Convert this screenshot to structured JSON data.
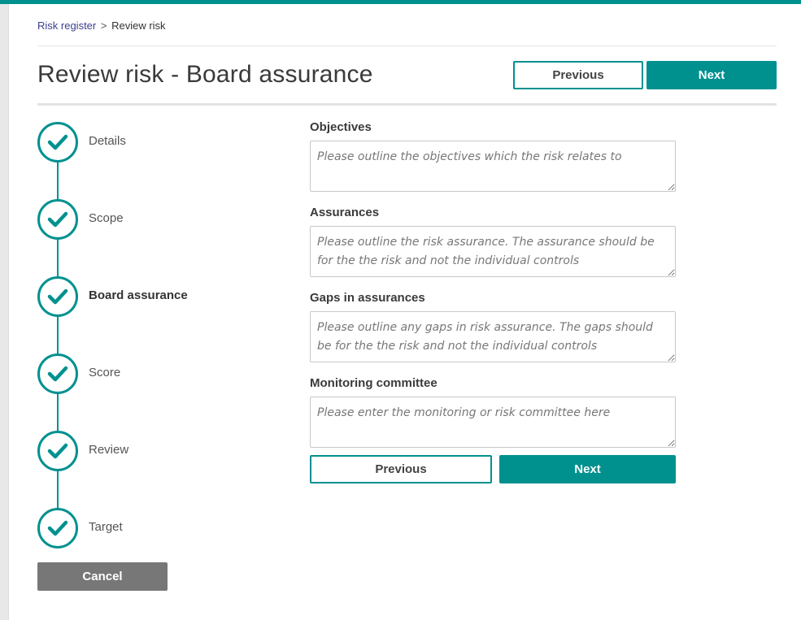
{
  "breadcrumb": {
    "parent": "Risk register",
    "separator": ">",
    "current": "Review risk"
  },
  "page": {
    "title": "Review risk - Board assurance"
  },
  "header_buttons": {
    "previous": "Previous",
    "next": "Next"
  },
  "steps": [
    {
      "label": "Details",
      "icon": "check-icon",
      "active": false
    },
    {
      "label": "Scope",
      "icon": "check-icon",
      "active": false
    },
    {
      "label": "Board assurance",
      "icon": "check-icon",
      "active": true
    },
    {
      "label": "Score",
      "icon": "check-icon",
      "active": false
    },
    {
      "label": "Review",
      "icon": "check-icon",
      "active": false
    },
    {
      "label": "Target",
      "icon": "check-icon",
      "active": false
    }
  ],
  "cancel_label": "Cancel",
  "form": {
    "objectives": {
      "label": "Objectives",
      "placeholder": "Please outline the objectives which the risk relates to",
      "value": ""
    },
    "assurances": {
      "label": "Assurances",
      "placeholder": "Please outline the risk assurance. The assurance should be for the the risk and not the individual controls",
      "value": ""
    },
    "gaps": {
      "label": "Gaps in assurances",
      "placeholder": "Please outline any gaps in risk assurance. The gaps should be for the the risk and not the individual controls",
      "value": ""
    },
    "committee": {
      "label": "Monitoring committee",
      "placeholder": "Please enter the monitoring or risk committee here",
      "value": ""
    }
  },
  "form_buttons": {
    "previous": "Previous",
    "next": "Next"
  },
  "colors": {
    "accent": "#00918f",
    "cancel": "#777777"
  }
}
